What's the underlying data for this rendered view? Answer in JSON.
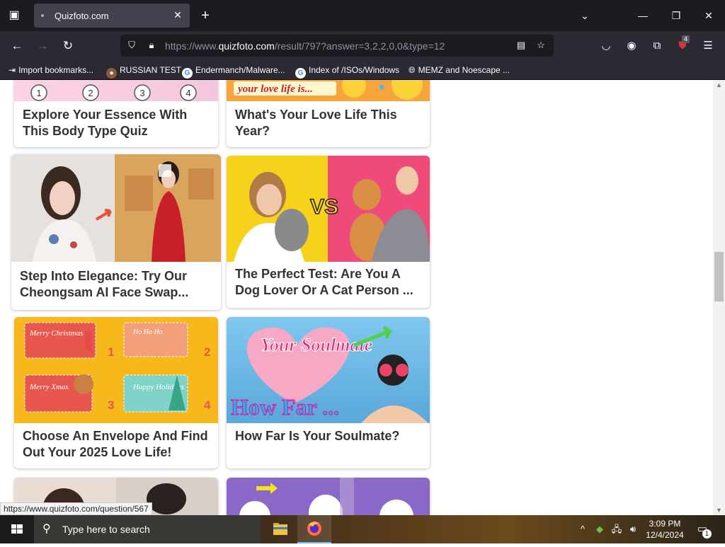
{
  "browser": {
    "tab_title": "Quizfoto.com",
    "url_prefix": "https://www.",
    "url_host": "quizfoto.com",
    "url_path": "/result/797?answer=3,2,2,0,0&type=12",
    "extension_badge": "4",
    "bookmarks": [
      {
        "label": "Import bookmarks...",
        "icon": "import-icon"
      },
      {
        "label": "RUSSIAN TEST",
        "icon": "site-icon"
      },
      {
        "label": "Endermanch/Malware...",
        "icon": "google-icon"
      },
      {
        "label": "Index of /ISOs/Windows",
        "icon": "google-icon"
      },
      {
        "label": "MEMZ and Noescape ...",
        "icon": "globe-icon"
      }
    ]
  },
  "quizzes": [
    {
      "title": "Explore Your Essence With This Body Type Quiz",
      "thumb_text": [
        "1",
        "2",
        "3",
        "4"
      ]
    },
    {
      "title": "What's Your Love Life This Year?",
      "thumb_text": "your love life is..."
    },
    {
      "title": "Step Into Elegance: Try Our Cheongsam AI Face Swap..."
    },
    {
      "title": "The Perfect Test: Are You A Dog Lover Or A Cat Person ...",
      "thumb_text": "VS"
    },
    {
      "title": "Choose An Envelope And Find Out Your 2025 Love Life!",
      "thumb_text": [
        "Merry Christmas",
        "Ho Ho Ho",
        "Merry Xmas",
        "Happy Holidays",
        "1",
        "2",
        "3",
        "4"
      ]
    },
    {
      "title": "How Far Is Your Soulmate?",
      "thumb_text": [
        "Your Soulmate",
        "How Far ..."
      ]
    }
  ],
  "status_tooltip": "https://www.quizfoto.com/question/567",
  "taskbar": {
    "search_placeholder": "Type here to search",
    "time": "3:09 PM",
    "date": "12/4/2024",
    "notification_count": "1"
  },
  "colors": {
    "tab_bar": "#1c1b22",
    "toolbar": "#2b2a33",
    "title_text": "#333333"
  }
}
